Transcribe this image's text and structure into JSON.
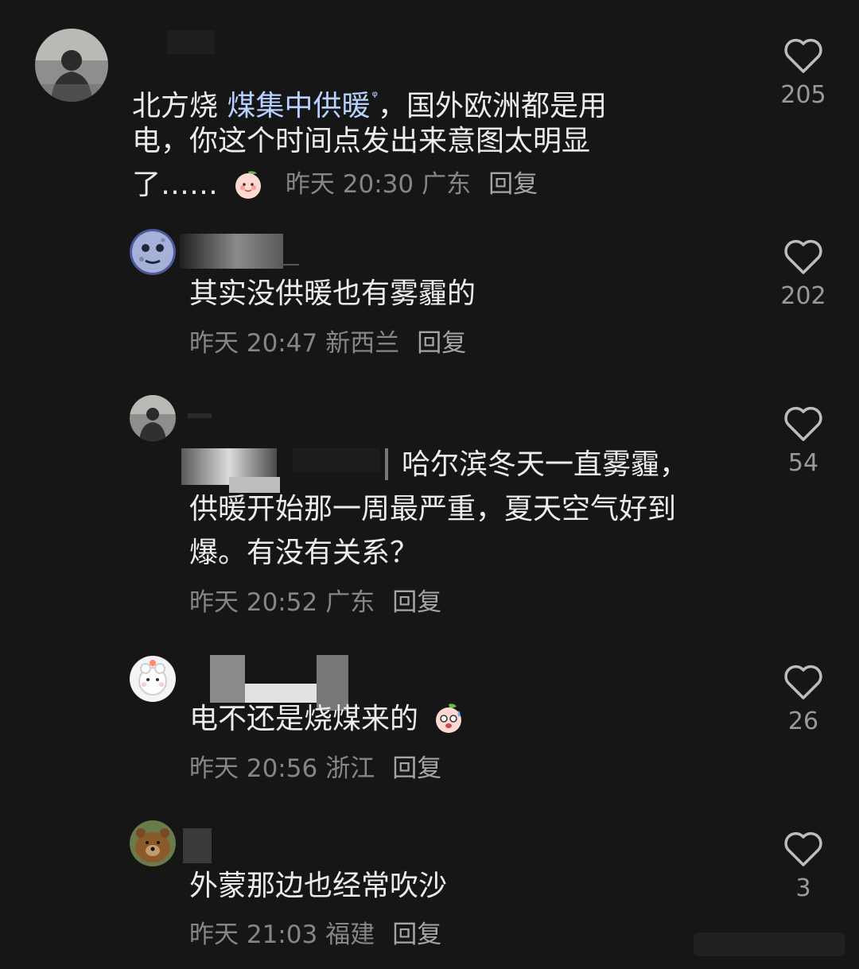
{
  "comments": [
    {
      "id": "c1",
      "text_before": "北方烧 ",
      "keyword": "煤集中供暖",
      "text_line1_after": "，国外欧洲都是用",
      "text_line2": "电，你这个时间点发出来意图太明显",
      "text_line3": "了……",
      "emoji": "peach-face-emoji",
      "time": "昨天 20:30",
      "location": "广东",
      "reply_label": "回复",
      "likes": "205"
    },
    {
      "id": "c2",
      "text_line1": "其实没供暖也有雾霾的",
      "time": "昨天 20:47",
      "location": "新西兰",
      "reply_label": "回复",
      "likes": "202"
    },
    {
      "id": "c3",
      "text_line1": "哈尔滨冬天一直雾霾，",
      "text_line2": "供暖开始那一周最严重，夏天空气好到",
      "text_line3": "爆。有没有关系？",
      "time": "昨天 20:52",
      "location": "广东",
      "reply_label": "回复",
      "likes": "54"
    },
    {
      "id": "c4",
      "text_line1": "电不还是烧煤来的",
      "emoji": "worried-peach-emoji",
      "time": "昨天 20:56",
      "location": "浙江",
      "reply_label": "回复",
      "likes": "26"
    },
    {
      "id": "c5",
      "text_line1": "外蒙那边也经常吹沙",
      "time": "昨天 21:03",
      "location": "福建",
      "reply_label": "回复",
      "likes": "3"
    }
  ],
  "colors": {
    "background": "#161616",
    "text": "#ececec",
    "keyword": "#b9d1ff",
    "meta": "#868686"
  }
}
